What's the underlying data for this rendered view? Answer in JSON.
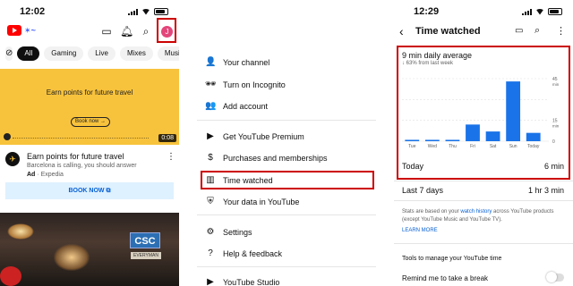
{
  "screens": {
    "home": {
      "time": "12:02",
      "top_icons": [
        "cast-icon",
        "bell-icon",
        "search-icon"
      ],
      "avatar_letter": "J",
      "chips": [
        "All",
        "Gaming",
        "Live",
        "Mixes",
        "Music"
      ],
      "ad": {
        "banner_title": "Earn points for future travel",
        "banner_button": "Book now →",
        "duration": "0:08",
        "title": "Earn points for future travel",
        "subtitle": "Barcelona is calling, you should answer",
        "ad_label": "Ad",
        "advertiser": " · Expedia",
        "book_now": "BOOK NOW"
      },
      "photo_sign": "CSC",
      "photo_sign_sub": "EVERYMAN"
    },
    "menu": {
      "items": [
        {
          "icon": "person-icon",
          "glyph": "👤",
          "label": "Your channel"
        },
        {
          "icon": "incognito-icon",
          "glyph": "🕶",
          "label": "Turn on Incognito"
        },
        {
          "icon": "add-account-icon",
          "glyph": "👥",
          "label": "Add account"
        },
        {
          "icon": "premium-icon",
          "glyph": "▶",
          "label": "Get YouTube Premium"
        },
        {
          "icon": "dollar-icon",
          "glyph": "$",
          "label": "Purchases and memberships"
        },
        {
          "icon": "bar-chart-icon",
          "glyph": "▥",
          "label": "Time watched"
        },
        {
          "icon": "shield-icon",
          "glyph": "⛨",
          "label": "Your data in YouTube"
        },
        {
          "icon": "gear-icon",
          "glyph": "⚙",
          "label": "Settings"
        },
        {
          "icon": "help-icon",
          "glyph": "?",
          "label": "Help & feedback"
        },
        {
          "icon": "studio-icon",
          "glyph": "▶",
          "label": "YouTube Studio"
        }
      ]
    },
    "time_watched": {
      "time": "12:29",
      "title": "Time watched",
      "daily_average": "9 min daily average",
      "change": "↓ 63% from last week",
      "today_label": "Today",
      "today_value": "6 min",
      "last7_label": "Last 7 days",
      "last7_value": "1 hr 3 min",
      "note_pre": "Stats are based on your ",
      "note_link": "watch history",
      "note_post": " across YouTube products (except YouTube Music and YouTube TV).",
      "learn_more": "LEARN MORE",
      "tools_heading": "Tools to manage your YouTube time",
      "remind_label": "Remind me to take a break"
    }
  },
  "chart_data": {
    "type": "bar",
    "categories": [
      "Tue",
      "Wed",
      "Thu",
      "Fri",
      "Sat",
      "Sun",
      "Today"
    ],
    "values": [
      1,
      1,
      1,
      12,
      7,
      43,
      6
    ],
    "ylim": [
      0,
      45
    ],
    "ytick_labels": [
      {
        "value": 45,
        "text": "45"
      },
      {
        "value": 30,
        "text": ""
      },
      {
        "value": 15,
        "text": "15"
      },
      {
        "value": 0,
        "text": "0"
      }
    ],
    "unit_label": "min",
    "grid": true,
    "bar_color": "#1a73e8"
  }
}
